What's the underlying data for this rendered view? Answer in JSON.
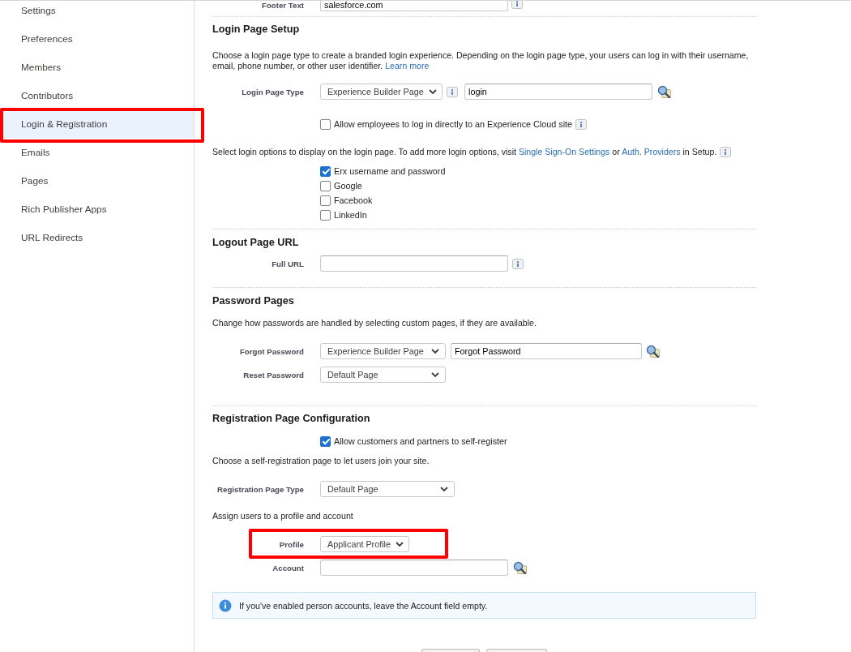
{
  "sidebar": {
    "items": [
      {
        "label": "Settings",
        "selected": false,
        "highlighted": false
      },
      {
        "label": "Preferences",
        "selected": false,
        "highlighted": false
      },
      {
        "label": "Members",
        "selected": false,
        "highlighted": false
      },
      {
        "label": "Contributors",
        "selected": false,
        "highlighted": false
      },
      {
        "label": "Login & Registration",
        "selected": true,
        "highlighted": true
      },
      {
        "label": "Emails",
        "selected": false,
        "highlighted": false
      },
      {
        "label": "Pages",
        "selected": false,
        "highlighted": false
      },
      {
        "label": "Rich Publisher Apps",
        "selected": false,
        "highlighted": false
      },
      {
        "label": "URL Redirects",
        "selected": false,
        "highlighted": false
      }
    ]
  },
  "footer_text": {
    "label": "Footer Text",
    "value": "salesforce.com"
  },
  "login_page_setup": {
    "title": "Login Page Setup",
    "description": "Choose a login page type to create a branded login experience. Depending on the login page type, your users can log in with their username, email, phone number, or other user identifier.",
    "learn_more": "Learn more",
    "login_page_type": {
      "label": "Login Page Type",
      "option": "Experience Builder Page",
      "page": "login"
    },
    "allow_employees": {
      "label": "Allow employees to log in directly to an Experience Cloud site",
      "checked": false
    },
    "options_intro": [
      {
        "kind": "text",
        "text": "Select login options to display on the login page. To add more login options, visit"
      },
      {
        "kind": "link",
        "text": "Single Sign-On Settings"
      },
      {
        "kind": "text",
        "text": "or"
      },
      {
        "kind": "link",
        "text": "Auth. Providers"
      },
      {
        "kind": "text",
        "text": "in Setup."
      }
    ],
    "login_options": [
      {
        "label": "Erx username and password",
        "checked": true
      },
      {
        "label": "Google",
        "checked": false
      },
      {
        "label": "Facebook",
        "checked": false
      },
      {
        "label": "LinkedIn",
        "checked": false
      }
    ]
  },
  "logout_page_url": {
    "title": "Logout Page URL",
    "full_url": {
      "label": "Full URL"
    }
  },
  "password_pages": {
    "title": "Password Pages",
    "description": "Change how passwords are handled by selecting custom pages, if they are available.",
    "forgot_password": {
      "label": "Forgot Password",
      "option": "Experience Builder Page",
      "page": "Forgot Password"
    },
    "reset_password": {
      "label": "Reset Password",
      "option": "Default Page"
    }
  },
  "registration": {
    "title": "Registration Page Configuration",
    "allow_self_register": {
      "label": "Allow customers and partners to self-register",
      "checked": true
    },
    "description": "Choose a self-registration page to let users join your site.",
    "registration_page_type": {
      "label": "Registration Page Type",
      "option": "Default Page"
    },
    "assign_text": "Assign users to a profile and account",
    "profile": {
      "label": "Profile",
      "option": "Applicant Profile",
      "highlighted": true
    },
    "account": {
      "label": "Account"
    }
  },
  "info_message": "If you've enabled person accounts, leave the Account field empty.",
  "footer_buttons": [
    {
      "kind": "button"
    },
    {
      "kind": "button"
    }
  ]
}
